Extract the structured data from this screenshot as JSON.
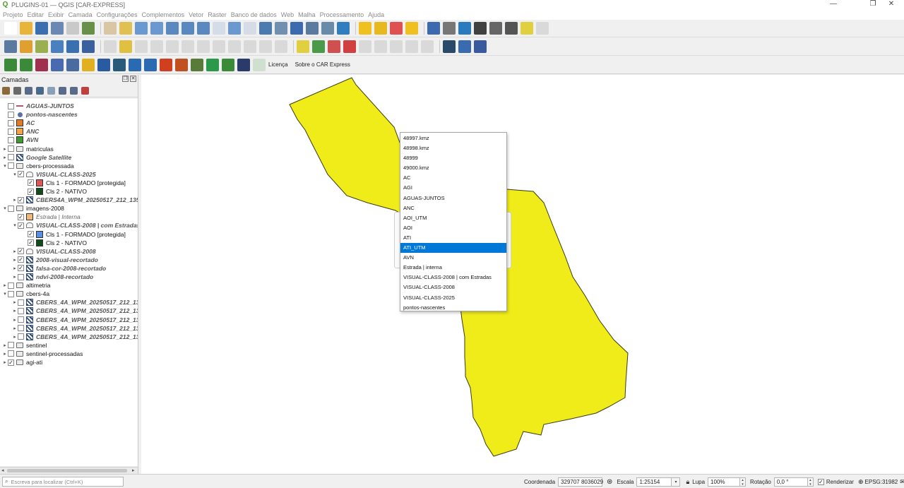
{
  "window": {
    "title": "PLUGINS-01 — QGIS [CAR-EXPRESS]",
    "logo_letter": "Q",
    "controls": {
      "minimize": "—",
      "restore": "❐",
      "close": "✕"
    }
  },
  "menubar": [
    "Projeto",
    "Editar",
    "Exibir",
    "Camada",
    "Configurações",
    "Complementos",
    "Vetor",
    "Raster",
    "Banco de dados",
    "Web",
    "Malha",
    "Processamento",
    "Ajuda"
  ],
  "toolbar3": {
    "license_label": "Licença",
    "about_label": "Sobre o CAR Express"
  },
  "layers_panel": {
    "title": "Camadas",
    "float_glyph": "❐",
    "close_glyph": "✕",
    "items": [
      {
        "label": "AGUAS-JUNTOS",
        "checked": false,
        "symbol": "line",
        "style": "it",
        "indent": 0,
        "arrow": ""
      },
      {
        "label": "pontos-nascentes",
        "checked": false,
        "symbol": "dot",
        "style": "it",
        "indent": 0,
        "arrow": ""
      },
      {
        "label": "AC",
        "checked": false,
        "symbol": "square",
        "color": "#e07b2a",
        "style": "it",
        "indent": 0,
        "arrow": ""
      },
      {
        "label": "ANC",
        "checked": false,
        "symbol": "square",
        "color": "#f2a447",
        "style": "it",
        "indent": 0,
        "arrow": ""
      },
      {
        "label": "AVN",
        "checked": false,
        "symbol": "square",
        "color": "#3f9a35",
        "style": "it",
        "indent": 0,
        "arrow": ""
      },
      {
        "label": "matriculas",
        "checked": false,
        "symbol": "folder",
        "style": "n",
        "indent": 0,
        "arrow": "▸"
      },
      {
        "label": "Google Satellite",
        "checked": false,
        "symbol": "raster",
        "style": "it",
        "indent": 0,
        "arrow": "▸"
      },
      {
        "label": "cbers-processada",
        "checked": false,
        "symbol": "folder",
        "style": "n",
        "indent": 0,
        "arrow": "▾"
      },
      {
        "label": "VISUAL-CLASS-2025",
        "checked": true,
        "symbol": "vecgroup",
        "style": "it",
        "indent": 1,
        "arrow": "▾"
      },
      {
        "label": "Cls 1 - FORMADO [protegida]",
        "checked": true,
        "symbol": "square",
        "color": "#e05555",
        "style": "n",
        "indent": 2,
        "arrow": ""
      },
      {
        "label": "Cls 2 - NATIVO",
        "checked": true,
        "symbol": "square",
        "color": "#114d1a",
        "style": "n",
        "indent": 2,
        "arrow": ""
      },
      {
        "label": "CBERS4A_WPM_20250517_212_135_L4_BAND",
        "checked": true,
        "symbol": "raster",
        "style": "it",
        "indent": 1,
        "arrow": "▸"
      },
      {
        "label": "imagens-2008",
        "checked": false,
        "symbol": "folder",
        "style": "n",
        "indent": 0,
        "arrow": "▾"
      },
      {
        "label": "Estrada | Interna",
        "checked": true,
        "symbol": "square",
        "color": "#f0b97a",
        "style": "itg",
        "indent": 1,
        "arrow": ""
      },
      {
        "label": "VISUAL-CLASS-2008 | com Estradas",
        "checked": true,
        "symbol": "vecgroup",
        "style": "it",
        "indent": 1,
        "arrow": "▾"
      },
      {
        "label": "Cls 1 - FORMADO [protegida]",
        "checked": true,
        "symbol": "square",
        "color": "#5b8ee0",
        "style": "n",
        "indent": 2,
        "arrow": ""
      },
      {
        "label": "Cls 2 - NATIVO",
        "checked": true,
        "symbol": "square",
        "color": "#114d1a",
        "style": "n",
        "indent": 2,
        "arrow": ""
      },
      {
        "label": "VISUAL-CLASS-2008",
        "checked": true,
        "symbol": "vecgroup",
        "style": "it",
        "indent": 1,
        "arrow": "▸"
      },
      {
        "label": "2008-visual-recortado",
        "checked": true,
        "symbol": "raster",
        "style": "it",
        "indent": 1,
        "arrow": "▸"
      },
      {
        "label": "falsa-cor-2008-recortado",
        "checked": true,
        "symbol": "raster",
        "style": "it",
        "indent": 1,
        "arrow": "▸"
      },
      {
        "label": "ndvi-2008-recortado",
        "checked": false,
        "symbol": "raster",
        "style": "it",
        "indent": 1,
        "arrow": "▸"
      },
      {
        "label": "altimetria",
        "checked": false,
        "symbol": "folder",
        "style": "n",
        "indent": 0,
        "arrow": "▸"
      },
      {
        "label": "cbers-4a",
        "checked": false,
        "symbol": "folder",
        "style": "n",
        "indent": 0,
        "arrow": "▾"
      },
      {
        "label": "CBERS_4A_WPM_20250517_212_135_L4_BAND1",
        "checked": false,
        "symbol": "raster",
        "style": "it",
        "indent": 1,
        "arrow": "▸"
      },
      {
        "label": "CBERS_4A_WPM_20250517_212_135_L4_BAND2",
        "checked": false,
        "symbol": "raster",
        "style": "it",
        "indent": 1,
        "arrow": "▸"
      },
      {
        "label": "CBERS_4A_WPM_20250517_212_135_L4_BAND3",
        "checked": false,
        "symbol": "raster",
        "style": "it",
        "indent": 1,
        "arrow": "▸"
      },
      {
        "label": "CBERS_4A_WPM_20250517_212_135_L4_BAND4",
        "checked": false,
        "symbol": "raster",
        "style": "it",
        "indent": 1,
        "arrow": "▸"
      },
      {
        "label": "CBERS_4A_WPM_20250517_212_135_L4_BAND0",
        "checked": false,
        "symbol": "raster",
        "style": "it",
        "indent": 1,
        "arrow": "▸"
      },
      {
        "label": "sentinel",
        "checked": false,
        "symbol": "folder",
        "style": "n",
        "indent": 0,
        "arrow": "▸"
      },
      {
        "label": "sentinel-processadas",
        "checked": false,
        "symbol": "folder",
        "style": "n",
        "indent": 0,
        "arrow": "▸"
      },
      {
        "label": "agi-ati",
        "checked": true,
        "symbol": "folder",
        "style": "n",
        "indent": 0,
        "arrow": "▸"
      }
    ]
  },
  "dropdown": {
    "selected": "ATI_UTM",
    "options": [
      "48997.kmz",
      "48998.kmz",
      "48999",
      "49000.kmz",
      "AC",
      "AGI",
      "AGUAS-JUNTOS",
      "ANC",
      "AOI_UTM",
      "AOI",
      "ATI",
      "ATI_UTM",
      "AVN",
      "Estrada | interna",
      "VISUAL-CLASS-2008 | com Estradas",
      "VISUAL-CLASS-2008",
      "VISUAL-CLASS-2025",
      "pontos-nascentes"
    ]
  },
  "map": {
    "fill_color": "#f0ec1a",
    "stroke_color": "#3a3a10"
  },
  "statusbar": {
    "locator_placeholder": "Escreva para localizar (Ctrl+K)",
    "coordinate_label": "Coordenada",
    "coordinate_value": "329707  8036029",
    "scale_label": "Escala",
    "scale_value": "1:25154",
    "magnifier_label": "Lupa",
    "magnifier_value": "100%",
    "rotation_label": "Rotação",
    "rotation_value": "0,0 °",
    "render_label": "Renderizar",
    "crs_label": "EPSG:31982"
  },
  "colors": {
    "selection": "#0078d7",
    "panel_bg": "#f0f0f0"
  }
}
